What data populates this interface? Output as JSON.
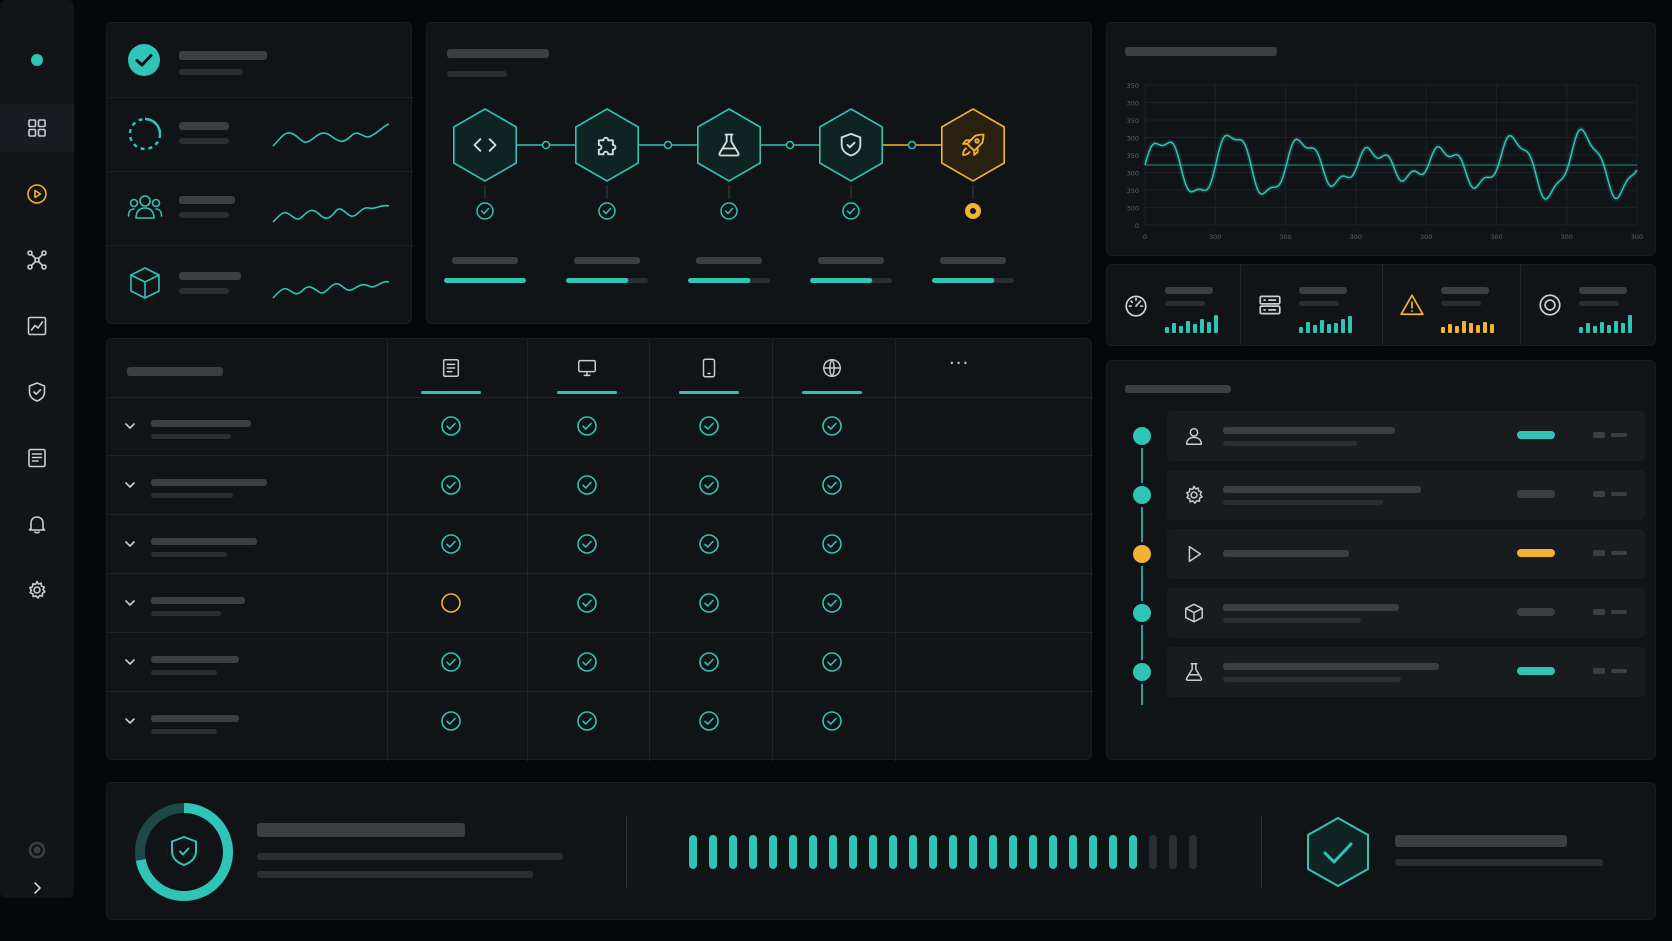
{
  "colors": {
    "accent": "#2ec4b6",
    "warning": "#f2b233",
    "panel": "#111417",
    "background": "#060708"
  },
  "sidebar": {
    "items": [
      {
        "name": "status-dot-icon",
        "active": true
      },
      {
        "name": "grid-icon"
      },
      {
        "name": "play-icon"
      },
      {
        "name": "nodes-icon"
      },
      {
        "name": "chart-icon"
      },
      {
        "name": "shield-icon"
      },
      {
        "name": "document-icon"
      },
      {
        "name": "bell-icon"
      },
      {
        "name": "gear-icon"
      }
    ],
    "footer": [
      {
        "name": "record-icon"
      },
      {
        "name": "chevron-right-icon"
      }
    ]
  },
  "status_list": {
    "items": [
      {
        "icon": "check-circle-icon",
        "sparkline": false
      },
      {
        "icon": "loading-ring-icon",
        "sparkline": true
      },
      {
        "icon": "users-icon",
        "sparkline": true
      },
      {
        "icon": "cube-icon",
        "sparkline": true
      }
    ]
  },
  "pipeline": {
    "stages": [
      {
        "icon": "code-icon",
        "status": "done",
        "progress": 1.0
      },
      {
        "icon": "puzzle-icon",
        "status": "done",
        "progress": 0.76
      },
      {
        "icon": "flask-icon",
        "status": "done",
        "progress": 0.76
      },
      {
        "icon": "shield-check-icon",
        "status": "done",
        "progress": 0.76
      },
      {
        "icon": "rocket-icon",
        "status": "pending",
        "progress": 0.76
      }
    ]
  },
  "waveform_chart": {
    "ytick_labels": [
      "350",
      "300",
      "350",
      "300",
      "350",
      "300",
      "350",
      "300",
      "0"
    ],
    "xtick_labels": [
      "0",
      "300",
      "300",
      "300",
      "300",
      "300",
      "300",
      "300"
    ]
  },
  "metrics": [
    {
      "icon": "gauge-icon",
      "tone": "accent",
      "bars": [
        0.3,
        0.5,
        0.35,
        0.6,
        0.45,
        0.7,
        0.55,
        0.9
      ]
    },
    {
      "icon": "server-icon",
      "tone": "accent",
      "bars": [
        0.3,
        0.55,
        0.4,
        0.65,
        0.45,
        0.5,
        0.7,
        0.85
      ]
    },
    {
      "icon": "warning-icon",
      "tone": "warning",
      "bars": [
        0.3,
        0.45,
        0.35,
        0.6,
        0.5,
        0.4,
        0.55,
        0.45
      ]
    },
    {
      "icon": "target-icon",
      "tone": "accent",
      "bars": [
        0.3,
        0.5,
        0.35,
        0.55,
        0.4,
        0.6,
        0.5,
        0.9
      ]
    }
  ],
  "matrix": {
    "columns": [
      {
        "icon": "document-icon"
      },
      {
        "icon": "monitor-icon"
      },
      {
        "icon": "tablet-icon"
      },
      {
        "icon": "globe-icon"
      },
      {
        "icon": "more-icon"
      }
    ],
    "more_label": "···",
    "rows": [
      [
        "ok",
        "ok",
        "ok",
        "ok"
      ],
      [
        "ok",
        "ok",
        "ok",
        "ok"
      ],
      [
        "ok",
        "ok",
        "ok",
        "ok"
      ],
      [
        "pending",
        "ok",
        "ok",
        "ok"
      ],
      [
        "ok",
        "ok",
        "ok",
        "ok"
      ],
      [
        "ok",
        "ok",
        "ok",
        "ok"
      ]
    ]
  },
  "timeline": {
    "events": [
      {
        "icon": "user-icon",
        "dot": "accent",
        "pill": "accent"
      },
      {
        "icon": "gear-icon",
        "dot": "accent",
        "pill": "neutral"
      },
      {
        "icon": "play-icon",
        "dot": "warning",
        "pill": "warning"
      },
      {
        "icon": "cube-icon",
        "dot": "accent",
        "pill": "neutral"
      },
      {
        "icon": "flask-icon",
        "dot": "accent",
        "pill": "accent"
      }
    ]
  },
  "security_summary": {
    "ring_progress": 0.72,
    "segments_filled": 23,
    "segments_total": 26
  }
}
